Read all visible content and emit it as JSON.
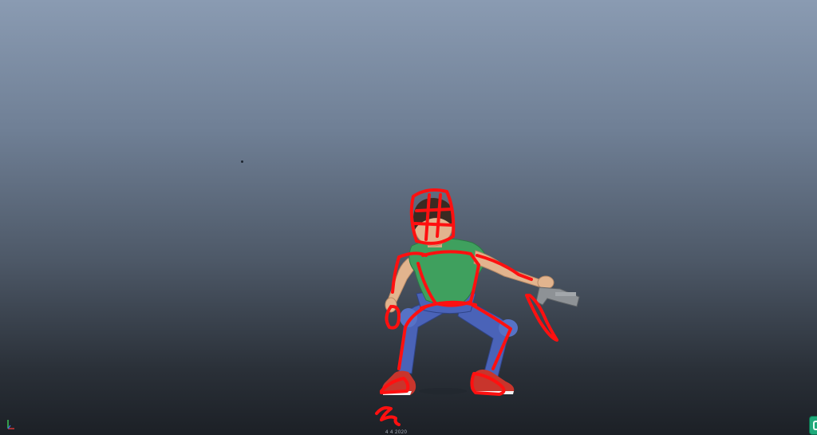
{
  "viewport": {
    "frame_label": "4 4 2020",
    "axis_labels": {
      "x": "x",
      "y": "y"
    }
  },
  "colors": {
    "gradient_top": "#8a9bb2",
    "gradient_bottom": "#1c2026",
    "sketch_overlay": "#ff1010",
    "shirt": "#3fa05e",
    "pants": "#4a63b8",
    "shoes": "#c8352c",
    "skin": "#e2b48e",
    "hair": "#3b2a22",
    "gun": "#8e9296",
    "side_button": "#1fa97a"
  },
  "icons": {
    "axis_gizmo": "xyz-axis-icon",
    "side_button": "side-panel-toggle-icon"
  }
}
